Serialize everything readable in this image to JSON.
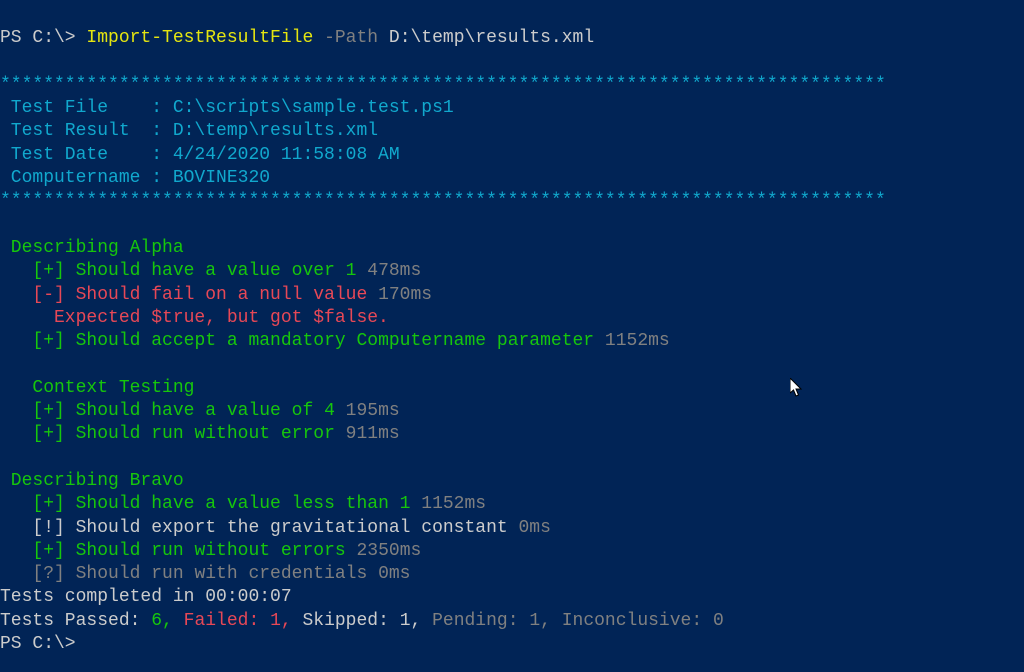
{
  "prompt": "PS C:\\> ",
  "cmd": {
    "name": "Import-TestResultFile",
    "param": "-Path",
    "arg": "D:\\temp\\results.xml"
  },
  "stars": "**********************************************************************************",
  "header": {
    "file_label": " Test File    : ",
    "file_value": "C:\\scripts\\sample.test.ps1",
    "result_label": " Test Result  : ",
    "result_value": "D:\\temp\\results.xml",
    "date_label": " Test Date    : ",
    "date_value": "4/24/2020 11:58:08 AM",
    "comp_label": " Computername : ",
    "comp_value": "BOVINE320"
  },
  "alpha": {
    "title": " Describing Alpha",
    "r1_mark": "   [+] ",
    "r1_text": "Should have a value over 1 ",
    "r1_time": "478ms",
    "r2_mark": "   [-] ",
    "r2_text": "Should fail on a null value ",
    "r2_time": "170ms",
    "r2_err": "     Expected $true, but got $false.",
    "r3_mark": "   [+] ",
    "r3_text": "Should accept a mandatory Computername parameter ",
    "r3_time": "1152ms",
    "ctx": "   Context Testing",
    "r4_mark": "   [+] ",
    "r4_text": "Should have a value of 4 ",
    "r4_time": "195ms",
    "r5_mark": "   [+] ",
    "r5_text": "Should run without error ",
    "r5_time": "911ms"
  },
  "bravo": {
    "title": " Describing Bravo",
    "r1_mark": "   [+] ",
    "r1_text": "Should have a value less than 1 ",
    "r1_time": "1152ms",
    "r2_mark": "   [!] ",
    "r2_text": "Should export the gravitational constant ",
    "r2_time": "0ms",
    "r3_mark": "   [+] ",
    "r3_text": "Should run without errors ",
    "r3_time": "2350ms",
    "r4_mark": "   [?] ",
    "r4_text": "Should run with credentials ",
    "r4_time": "0ms"
  },
  "summary": {
    "completed": "Tests completed in 00:00:07",
    "passed_label": "Tests Passed: ",
    "passed_value": "6, ",
    "failed_label": "Failed: ",
    "failed_value": "1, ",
    "skipped_label": "Skipped: ",
    "skipped_value": "1, ",
    "pending_label": "Pending: ",
    "pending_value": "1, ",
    "inconclusive_label": "Inconclusive: ",
    "inconclusive_value": "0"
  },
  "final_prompt": "PS C:\\>"
}
